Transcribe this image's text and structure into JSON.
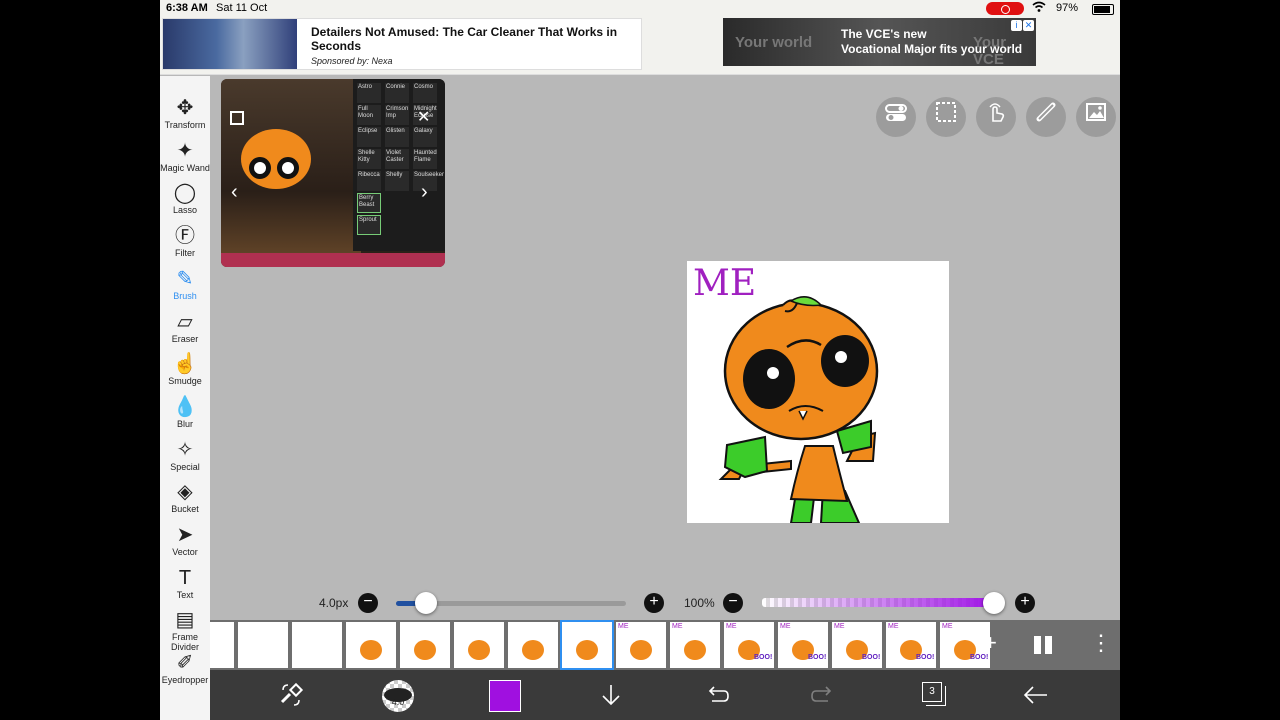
{
  "status_bar": {
    "time": "6:38 AM",
    "date": "Sat 11 Oct",
    "battery": "97%"
  },
  "ads": {
    "left": {
      "headline": "Detailers Not Amused: The Car Cleaner That Works in Seconds",
      "sponsor": "Sponsored by: Nexa"
    },
    "right": {
      "bg_text_1": "Your world",
      "bg_text_2": "Your VCE",
      "line1": "The VCE's new",
      "line2": "Vocational Major fits your world"
    }
  },
  "toolbar": {
    "tools": [
      {
        "label": "Transform",
        "icon": "move-icon"
      },
      {
        "label": "Magic Wand",
        "icon": "magic-wand-icon"
      },
      {
        "label": "Lasso",
        "icon": "lasso-icon"
      },
      {
        "label": "Filter",
        "icon": "fx-icon"
      },
      {
        "label": "Brush",
        "icon": "brush-icon",
        "active": true
      },
      {
        "label": "Eraser",
        "icon": "eraser-icon"
      },
      {
        "label": "Smudge",
        "icon": "smudge-icon"
      },
      {
        "label": "Blur",
        "icon": "blur-drop-icon"
      },
      {
        "label": "Special",
        "icon": "sparkle-icon"
      },
      {
        "label": "Bucket",
        "icon": "bucket-icon"
      },
      {
        "label": "Vector",
        "icon": "cursor-icon"
      },
      {
        "label": "Text",
        "icon": "text-icon"
      },
      {
        "label": "Frame Divider",
        "icon": "frame-divider-icon"
      },
      {
        "label": "Eyedropper",
        "icon": "eyedropper-icon"
      }
    ]
  },
  "video_preview": {
    "grid": [
      [
        "Astro",
        "Connie",
        "Cosmo"
      ],
      [
        "Full Moon",
        "Crimson Imp",
        "Midnight Eclipse"
      ],
      [
        "Eclipse",
        "Glisten",
        "Galaxy"
      ],
      [
        "Shelle Kitty",
        "Violet Caster",
        "Haunted Flame"
      ],
      [
        "Ribecca",
        "Shelly",
        "Soulseeker"
      ],
      [
        "Berry Beast",
        "",
        ""
      ],
      [
        "Sprout",
        "",
        ""
      ]
    ]
  },
  "quick_buttons": [
    "toggle-icon",
    "selection-icon",
    "touch-icon",
    "ruler-icon",
    "image-icon"
  ],
  "canvas": {
    "text": "ME",
    "text_color": "#a020c0"
  },
  "sliders": {
    "brush_size_label": "4.0px",
    "brush_size_value": 0.13,
    "opacity_label": "100%",
    "opacity_value": 1.0
  },
  "frame_strip": {
    "current_index": 7,
    "frames": [
      {
        "type": "partial"
      },
      {
        "type": "blank"
      },
      {
        "type": "blank"
      },
      {
        "type": "pumpkin"
      },
      {
        "type": "pumpkin"
      },
      {
        "type": "pumpkin"
      },
      {
        "type": "pumpkin"
      },
      {
        "type": "pumpkin"
      },
      {
        "type": "pumpkin-me"
      },
      {
        "type": "pumpkin-me"
      },
      {
        "type": "pumpkin-boo"
      },
      {
        "type": "pumpkin-boo"
      },
      {
        "type": "pumpkin-boo"
      },
      {
        "type": "pumpkin-boo"
      },
      {
        "type": "pumpkin-boo"
      }
    ],
    "boo_text": "BOO!",
    "mini_me_text": "ME"
  },
  "bottom_bar": {
    "brush_size": "4.0",
    "color": "#a010e0",
    "layer_count": "3"
  }
}
